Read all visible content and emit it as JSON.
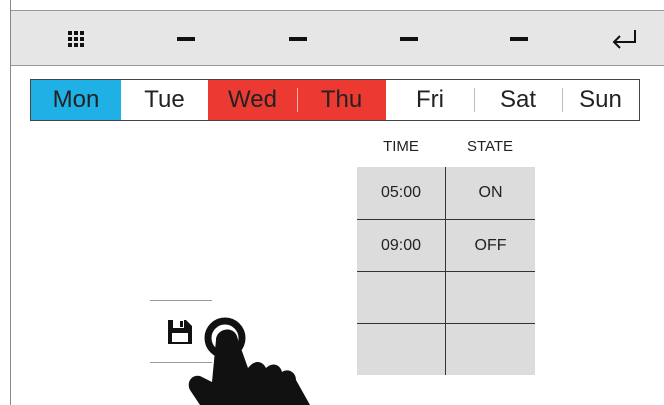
{
  "toolbar": {
    "buttons": [
      {
        "name": "grid-menu-button",
        "icon": "grid-icon"
      },
      {
        "name": "dash-button-1",
        "icon": "dash-icon"
      },
      {
        "name": "dash-button-2",
        "icon": "dash-icon"
      },
      {
        "name": "dash-button-3",
        "icon": "dash-icon"
      },
      {
        "name": "dash-button-4",
        "icon": "dash-icon"
      },
      {
        "name": "back-button",
        "icon": "return-arrow-icon"
      }
    ]
  },
  "days": [
    {
      "label": "Mon",
      "state": "active"
    },
    {
      "label": "Tue",
      "state": "normal"
    },
    {
      "label": "Wed",
      "state": "selected"
    },
    {
      "label": "Thu",
      "state": "selected"
    },
    {
      "label": "Fri",
      "state": "normal"
    },
    {
      "label": "Sat",
      "state": "normal"
    },
    {
      "label": "Sun",
      "state": "normal"
    }
  ],
  "schedule": {
    "headers": {
      "time": "TIME",
      "state": "STATE"
    },
    "rows": [
      {
        "time": "05:00",
        "state": "ON"
      },
      {
        "time": "09:00",
        "state": "OFF"
      },
      {
        "time": "",
        "state": ""
      },
      {
        "time": "",
        "state": ""
      }
    ]
  },
  "colors": {
    "active_day": "#1fb0e6",
    "selected_day": "#ec3a32",
    "toolbar_bg": "#e6e6e6",
    "cell_bg": "#dcdcdc"
  },
  "icons": {
    "save": "floppy-disk-icon",
    "pointer": "hand-pointer-icon"
  }
}
